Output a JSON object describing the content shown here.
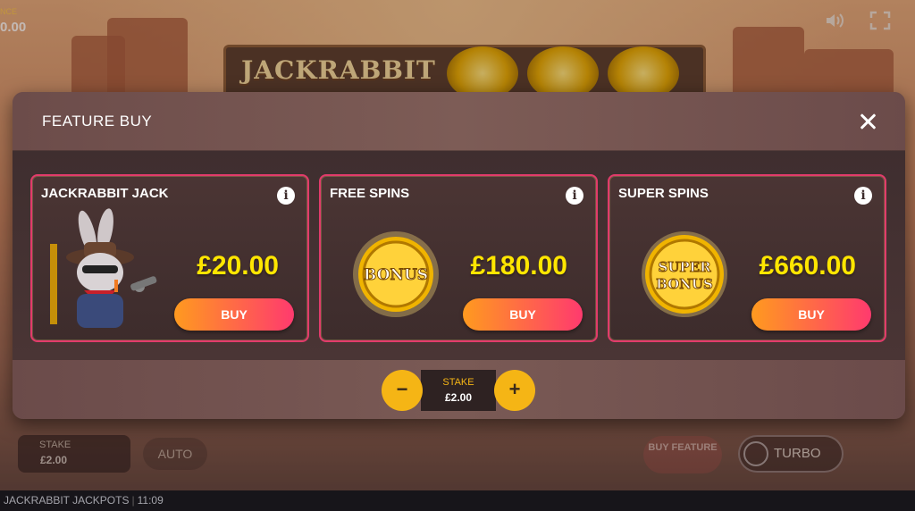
{
  "game": {
    "sign_text": "JACKRABBIT",
    "balance_label": "NCE",
    "balance_value": "0.00"
  },
  "modal": {
    "title": "FEATURE BUY",
    "cards": [
      {
        "title": "JACKRABBIT JACK",
        "price": "£20.00",
        "buy_label": "BUY",
        "image": "jackrabbit-character"
      },
      {
        "title": "FREE SPINS",
        "price": "£180.00",
        "buy_label": "BUY",
        "image": "bonus-coin",
        "coin_text": "BONUS"
      },
      {
        "title": "SUPER SPINS",
        "price": "£660.00",
        "buy_label": "BUY",
        "image": "super-bonus-coin",
        "coin_text_1": "SUPER",
        "coin_text_2": "BONUS"
      }
    ],
    "stake": {
      "label": "STAKE",
      "value": "£2.00",
      "minus": "−",
      "plus": "+"
    }
  },
  "hud": {
    "stake_label": "STAKE",
    "stake_value": "£2.00",
    "auto_label": "AUTO",
    "buy_feature_label": "BUY FEATURE",
    "turbo_label": "TURBO"
  },
  "status_bar": {
    "game_name": "JACKRABBIT JACKPOTS",
    "time": "11:09"
  },
  "colors": {
    "accent_yellow": "#ffe600",
    "card_border": "#e23b6b",
    "buy_gradient_start": "#ff9a1f",
    "buy_gradient_end": "#ff3a6e",
    "stake_button": "#f5b515"
  }
}
